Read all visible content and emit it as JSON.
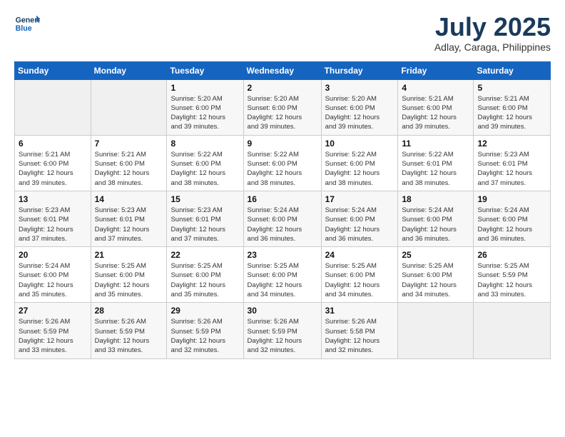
{
  "logo": {
    "line1": "General",
    "line2": "Blue"
  },
  "title": "July 2025",
  "location": "Adlay, Caraga, Philippines",
  "weekdays": [
    "Sunday",
    "Monday",
    "Tuesday",
    "Wednesday",
    "Thursday",
    "Friday",
    "Saturday"
  ],
  "weeks": [
    [
      {
        "day": "",
        "info": ""
      },
      {
        "day": "",
        "info": ""
      },
      {
        "day": "1",
        "info": "Sunrise: 5:20 AM\nSunset: 6:00 PM\nDaylight: 12 hours\nand 39 minutes."
      },
      {
        "day": "2",
        "info": "Sunrise: 5:20 AM\nSunset: 6:00 PM\nDaylight: 12 hours\nand 39 minutes."
      },
      {
        "day": "3",
        "info": "Sunrise: 5:20 AM\nSunset: 6:00 PM\nDaylight: 12 hours\nand 39 minutes."
      },
      {
        "day": "4",
        "info": "Sunrise: 5:21 AM\nSunset: 6:00 PM\nDaylight: 12 hours\nand 39 minutes."
      },
      {
        "day": "5",
        "info": "Sunrise: 5:21 AM\nSunset: 6:00 PM\nDaylight: 12 hours\nand 39 minutes."
      }
    ],
    [
      {
        "day": "6",
        "info": "Sunrise: 5:21 AM\nSunset: 6:00 PM\nDaylight: 12 hours\nand 39 minutes."
      },
      {
        "day": "7",
        "info": "Sunrise: 5:21 AM\nSunset: 6:00 PM\nDaylight: 12 hours\nand 38 minutes."
      },
      {
        "day": "8",
        "info": "Sunrise: 5:22 AM\nSunset: 6:00 PM\nDaylight: 12 hours\nand 38 minutes."
      },
      {
        "day": "9",
        "info": "Sunrise: 5:22 AM\nSunset: 6:00 PM\nDaylight: 12 hours\nand 38 minutes."
      },
      {
        "day": "10",
        "info": "Sunrise: 5:22 AM\nSunset: 6:00 PM\nDaylight: 12 hours\nand 38 minutes."
      },
      {
        "day": "11",
        "info": "Sunrise: 5:22 AM\nSunset: 6:01 PM\nDaylight: 12 hours\nand 38 minutes."
      },
      {
        "day": "12",
        "info": "Sunrise: 5:23 AM\nSunset: 6:01 PM\nDaylight: 12 hours\nand 37 minutes."
      }
    ],
    [
      {
        "day": "13",
        "info": "Sunrise: 5:23 AM\nSunset: 6:01 PM\nDaylight: 12 hours\nand 37 minutes."
      },
      {
        "day": "14",
        "info": "Sunrise: 5:23 AM\nSunset: 6:01 PM\nDaylight: 12 hours\nand 37 minutes."
      },
      {
        "day": "15",
        "info": "Sunrise: 5:23 AM\nSunset: 6:01 PM\nDaylight: 12 hours\nand 37 minutes."
      },
      {
        "day": "16",
        "info": "Sunrise: 5:24 AM\nSunset: 6:00 PM\nDaylight: 12 hours\nand 36 minutes."
      },
      {
        "day": "17",
        "info": "Sunrise: 5:24 AM\nSunset: 6:00 PM\nDaylight: 12 hours\nand 36 minutes."
      },
      {
        "day": "18",
        "info": "Sunrise: 5:24 AM\nSunset: 6:00 PM\nDaylight: 12 hours\nand 36 minutes."
      },
      {
        "day": "19",
        "info": "Sunrise: 5:24 AM\nSunset: 6:00 PM\nDaylight: 12 hours\nand 36 minutes."
      }
    ],
    [
      {
        "day": "20",
        "info": "Sunrise: 5:24 AM\nSunset: 6:00 PM\nDaylight: 12 hours\nand 35 minutes."
      },
      {
        "day": "21",
        "info": "Sunrise: 5:25 AM\nSunset: 6:00 PM\nDaylight: 12 hours\nand 35 minutes."
      },
      {
        "day": "22",
        "info": "Sunrise: 5:25 AM\nSunset: 6:00 PM\nDaylight: 12 hours\nand 35 minutes."
      },
      {
        "day": "23",
        "info": "Sunrise: 5:25 AM\nSunset: 6:00 PM\nDaylight: 12 hours\nand 34 minutes."
      },
      {
        "day": "24",
        "info": "Sunrise: 5:25 AM\nSunset: 6:00 PM\nDaylight: 12 hours\nand 34 minutes."
      },
      {
        "day": "25",
        "info": "Sunrise: 5:25 AM\nSunset: 6:00 PM\nDaylight: 12 hours\nand 34 minutes."
      },
      {
        "day": "26",
        "info": "Sunrise: 5:25 AM\nSunset: 5:59 PM\nDaylight: 12 hours\nand 33 minutes."
      }
    ],
    [
      {
        "day": "27",
        "info": "Sunrise: 5:26 AM\nSunset: 5:59 PM\nDaylight: 12 hours\nand 33 minutes."
      },
      {
        "day": "28",
        "info": "Sunrise: 5:26 AM\nSunset: 5:59 PM\nDaylight: 12 hours\nand 33 minutes."
      },
      {
        "day": "29",
        "info": "Sunrise: 5:26 AM\nSunset: 5:59 PM\nDaylight: 12 hours\nand 32 minutes."
      },
      {
        "day": "30",
        "info": "Sunrise: 5:26 AM\nSunset: 5:59 PM\nDaylight: 12 hours\nand 32 minutes."
      },
      {
        "day": "31",
        "info": "Sunrise: 5:26 AM\nSunset: 5:58 PM\nDaylight: 12 hours\nand 32 minutes."
      },
      {
        "day": "",
        "info": ""
      },
      {
        "day": "",
        "info": ""
      }
    ]
  ]
}
